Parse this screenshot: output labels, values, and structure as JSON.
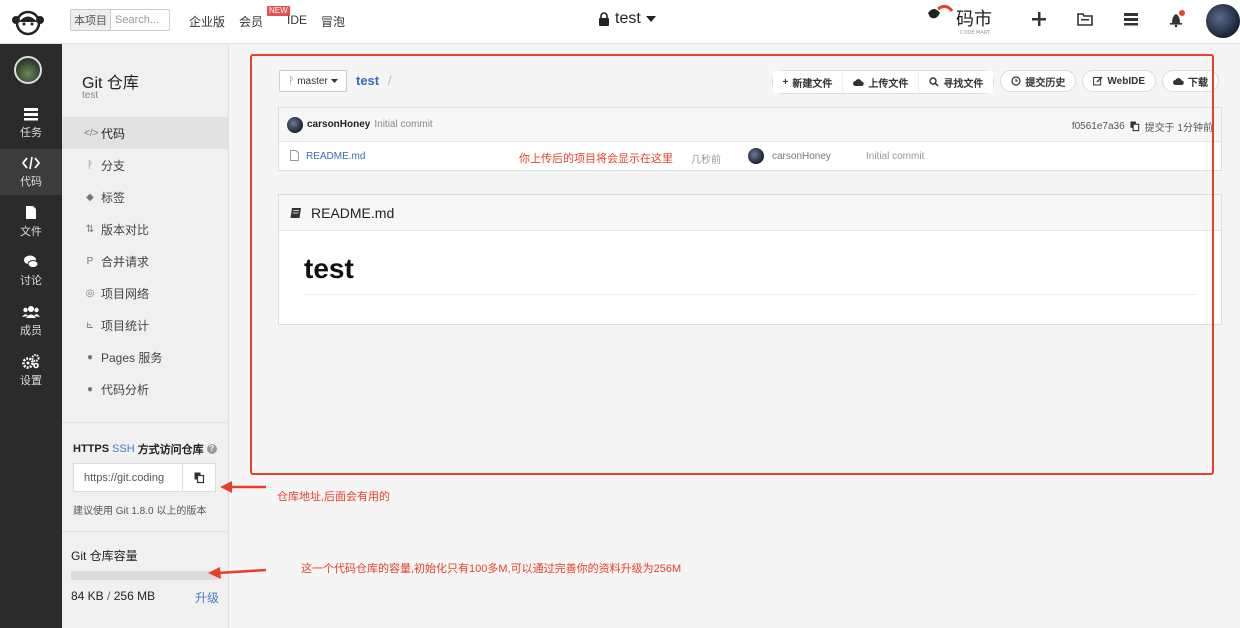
{
  "topbar": {
    "search_scope": "本项目",
    "search_placeholder": "Search...",
    "nav": [
      "企业版",
      "会员",
      "IDE",
      "冒泡"
    ],
    "new_badge": "NEW",
    "project_title": "test",
    "brand_text": "码市",
    "brand_sub": "CODE MART"
  },
  "rail": [
    {
      "label": "任务",
      "icon": "tasks-icon"
    },
    {
      "label": "代码",
      "icon": "code-icon"
    },
    {
      "label": "文件",
      "icon": "file-icon"
    },
    {
      "label": "讨论",
      "icon": "discuss-icon"
    },
    {
      "label": "成员",
      "icon": "members-icon"
    },
    {
      "label": "设置",
      "icon": "settings-icon"
    }
  ],
  "sidebar": {
    "title": "Git 仓库",
    "subtitle": "test",
    "items": [
      {
        "glyph": "</>",
        "label": "代码"
      },
      {
        "glyph": "ᚹ",
        "label": "分支"
      },
      {
        "glyph": "◆",
        "label": "标签"
      },
      {
        "glyph": "⇅",
        "label": "版本对比"
      },
      {
        "glyph": "P",
        "label": "合并请求"
      },
      {
        "glyph": "◎",
        "label": "项目网络"
      },
      {
        "glyph": "⊾",
        "label": "项目统计"
      },
      {
        "glyph": "●",
        "label": "Pages 服务"
      },
      {
        "glyph": "●",
        "label": "代码分析"
      }
    ],
    "access_https": "HTTPS",
    "access_ssh": "SSH",
    "access_title": "方式访问仓库",
    "repo_url": "https://git.coding",
    "git_version_note": "建议使用 Git 1.8.0 以上的版本",
    "capacity_title": "Git 仓库容量",
    "capacity_used": "84 KB",
    "capacity_sep": "/",
    "capacity_total": "256 MB",
    "capacity_fraction": 0.0003,
    "upgrade": "升级"
  },
  "toolbar": {
    "branch": "master",
    "path": "test",
    "path_sep": "/",
    "buttons": [
      "新建文件",
      "上传文件",
      "寻找文件"
    ],
    "history": "提交历史",
    "webide": "WebIDE",
    "download": "下载"
  },
  "commit": {
    "author": "carsonHoney",
    "message": "Initial commit",
    "hash": "f0561e7a36",
    "time": "提交于 1分钟前"
  },
  "files": [
    {
      "name": "README.md",
      "time": "几秒前",
      "author": "carsonHoney",
      "message": "Initial commit"
    }
  ],
  "readme": {
    "filename": "README.md",
    "heading": "test"
  },
  "annotations": {
    "files_note": "你上传后的项目将会显示在这里",
    "url_note": "仓库地址,后面会有用的",
    "capacity_note": "这一个代码仓库的容量,初始化只有100多M,可以通过完善你的资料升级为256M"
  },
  "colors": {
    "accent_red": "#e8402a",
    "link_blue": "#3a6cb8",
    "rail_dark": "#2b2b2b"
  }
}
